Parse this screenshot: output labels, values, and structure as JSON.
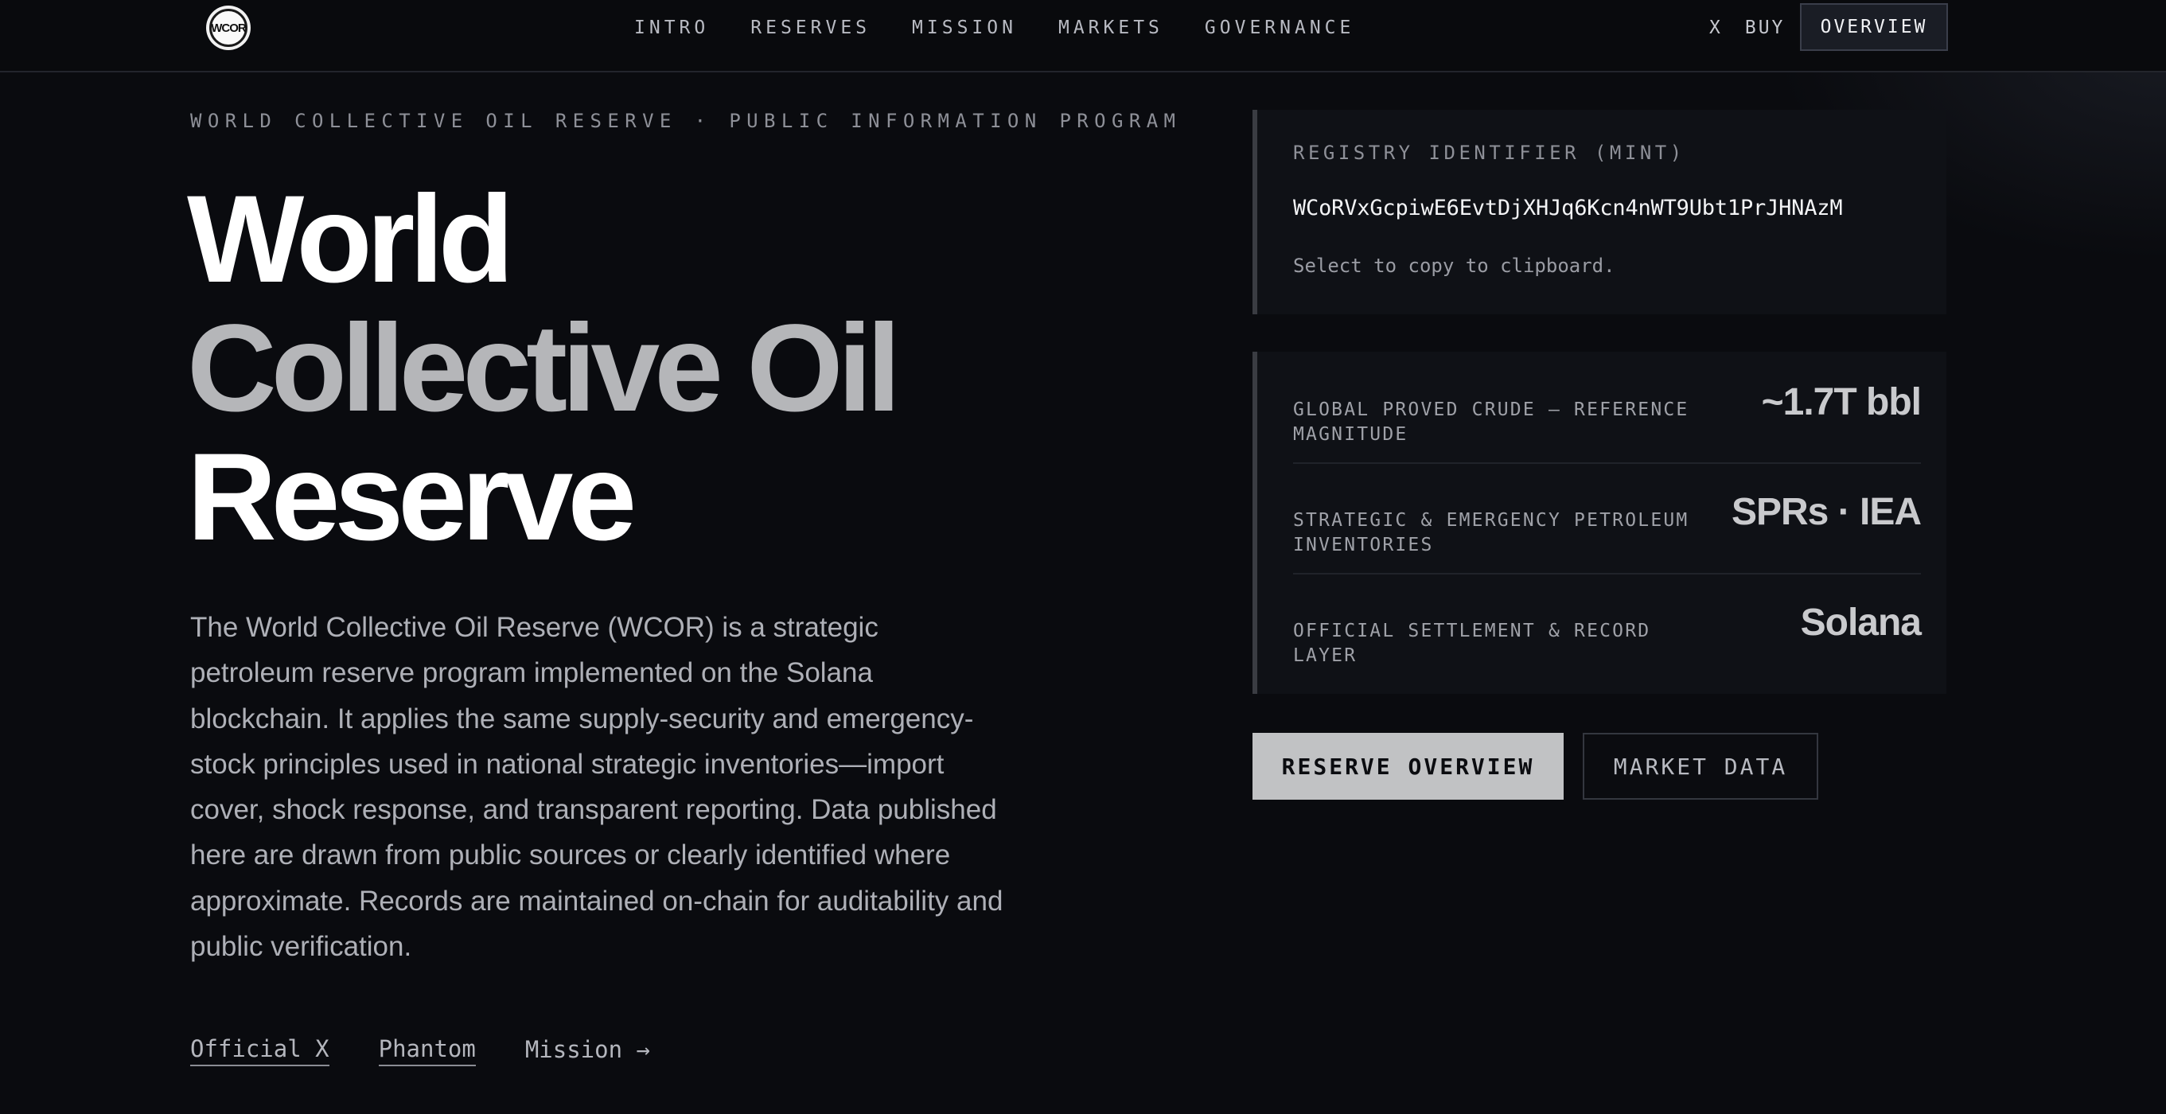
{
  "nav": {
    "logo_text": "WCOR",
    "links": [
      "INTRO",
      "RESERVES",
      "MISSION",
      "MARKETS",
      "GOVERNANCE"
    ],
    "x_label": "X",
    "buy_label": "BUY",
    "overview_label": "OVERVIEW"
  },
  "hero": {
    "eyebrow": "WORLD COLLECTIVE OIL RESERVE · PUBLIC INFORMATION PROGRAM",
    "title_line1": "World",
    "title_line2": "Collective Oil",
    "title_line3": "Reserve",
    "description": "The World Collective Oil Reserve (WCOR) is a strategic petroleum reserve program implemented on the Solana blockchain. It applies the same supply-security and emergency-stock principles used in national strategic inventories—import cover, shock response, and transparent reporting. Data published here are drawn from public sources or clearly identified where approximate. Records are maintained on-chain for auditability and public verification.",
    "links": {
      "official_x": "Official X",
      "phantom": "Phantom",
      "mission": "Mission →"
    }
  },
  "registry": {
    "label": "REGISTRY IDENTIFIER (MINT)",
    "value": "WCoRVxGcpiwE6EvtDjXHJq6Kcn4nWT9Ubt1PrJHNAzM",
    "hint": "Select to copy to clipboard."
  },
  "stats": [
    {
      "label": "GLOBAL PROVED CRUDE — REFERENCE MAGNITUDE",
      "value": "~1.7T bbl"
    },
    {
      "label": "STRATEGIC & EMERGENCY PETROLEUM INVENTORIES",
      "value": "SPRs · IEA"
    },
    {
      "label": "OFFICIAL SETTLEMENT & RECORD LAYER",
      "value": "Solana"
    }
  ],
  "actions": {
    "primary": "RESERVE OVERVIEW",
    "secondary": "MARKET DATA"
  }
}
